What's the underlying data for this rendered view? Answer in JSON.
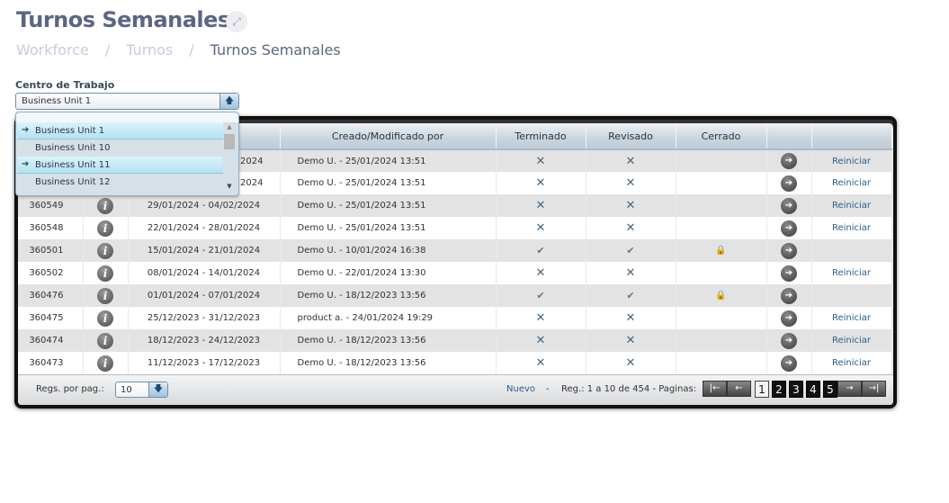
{
  "header": {
    "title": "Turnos Semanales",
    "breadcrumb": [
      "Workforce",
      "Turnos",
      "Turnos Semanales"
    ]
  },
  "filter": {
    "label": "Centro de Trabajo",
    "value": "Business Unit 1",
    "options": [
      {
        "label": "Business Unit 1",
        "marked": true
      },
      {
        "label": "Business Unit 10",
        "marked": false
      },
      {
        "label": "Business Unit 11",
        "marked": true
      },
      {
        "label": "Business Unit 12",
        "marked": false
      }
    ]
  },
  "table": {
    "columns": [
      "",
      "",
      "",
      "Creado/Modificado por",
      "Terminado",
      "Revisado",
      "Cerrado",
      "",
      ""
    ],
    "rows": [
      {
        "id": "",
        "info": "i",
        "dates": "2024",
        "created": "Demo U. - 25/01/2024 13:51",
        "terminado": "x",
        "revisado": "x",
        "cerrado": "",
        "action": "Reiniciar"
      },
      {
        "id": "",
        "info": "i",
        "dates": "2024",
        "created": "Demo U. - 25/01/2024 13:51",
        "terminado": "x",
        "revisado": "x",
        "cerrado": "",
        "action": "Reiniciar"
      },
      {
        "id": "360549",
        "info": "i",
        "dates": "29/01/2024 - 04/02/2024",
        "created": "Demo U. - 25/01/2024 13:51",
        "terminado": "x",
        "revisado": "x",
        "cerrado": "",
        "action": "Reiniciar"
      },
      {
        "id": "360548",
        "info": "i",
        "dates": "22/01/2024 - 28/01/2024",
        "created": "Demo U. - 25/01/2024 13:51",
        "terminado": "x",
        "revisado": "x",
        "cerrado": "",
        "action": "Reiniciar"
      },
      {
        "id": "360501",
        "info": "i",
        "dates": "15/01/2024 - 21/01/2024",
        "created": "Demo U. - 10/01/2024 16:38",
        "terminado": "check",
        "revisado": "check",
        "cerrado": "lock",
        "action": ""
      },
      {
        "id": "360502",
        "info": "i",
        "dates": "08/01/2024 - 14/01/2024",
        "created": "Demo U. - 22/01/2024 13:30",
        "terminado": "x",
        "revisado": "x",
        "cerrado": "",
        "action": "Reiniciar"
      },
      {
        "id": "360476",
        "info": "i",
        "dates": "01/01/2024 - 07/01/2024",
        "created": "Demo U. - 18/12/2023 13:56",
        "terminado": "check",
        "revisado": "check",
        "cerrado": "lock",
        "action": ""
      },
      {
        "id": "360475",
        "info": "i",
        "dates": "25/12/2023 - 31/12/2023",
        "created": "product a. - 24/01/2024 19:29",
        "terminado": "x",
        "revisado": "x",
        "cerrado": "",
        "action": "Reiniciar"
      },
      {
        "id": "360474",
        "info": "i",
        "dates": "18/12/2023 - 24/12/2023",
        "created": "Demo U. - 18/12/2023 13:56",
        "terminado": "x",
        "revisado": "x",
        "cerrado": "",
        "action": "Reiniciar"
      },
      {
        "id": "360473",
        "info": "i",
        "dates": "11/12/2023 - 17/12/2023",
        "created": "Demo U. - 18/12/2023 13:56",
        "terminado": "x",
        "revisado": "x",
        "cerrado": "",
        "action": "Reiniciar"
      }
    ]
  },
  "footer": {
    "rows_per_page_label": "Regs. por pag.:",
    "rows_per_page": "10",
    "new_label": "Nuevo",
    "dash": "-",
    "records": "Reg.: 1 a 10 de 454 - Paginas:",
    "pages": [
      "1",
      "2",
      "3",
      "4",
      "5"
    ],
    "current_page": "1"
  }
}
